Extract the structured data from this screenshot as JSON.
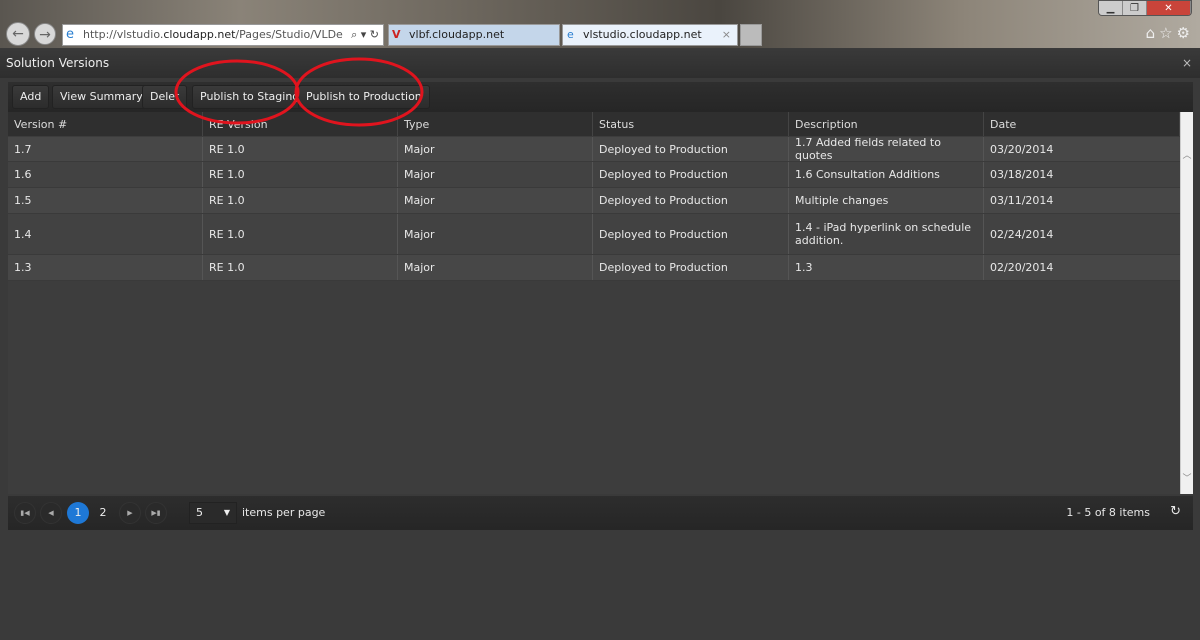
{
  "browser": {
    "url_prefix": "http://vlstudio.",
    "url_domain": "cloudapp.net",
    "url_path": "/Pages/Studio/VLDe",
    "tabs": [
      {
        "label": "vlbf.cloudapp.net"
      },
      {
        "label": "vlstudio.cloudapp.net"
      }
    ],
    "tab_close": "×"
  },
  "window": {
    "title": "Solution Versions",
    "close": "×"
  },
  "toolbar": {
    "add": "Add",
    "view_summary": "View Summary",
    "delete": "Delet",
    "publish_staging": "Publish to Staging",
    "publish_production": "Publish to Production"
  },
  "grid": {
    "columns": [
      "Version #",
      "RE Version",
      "Type",
      "Status",
      "Description",
      "Date"
    ],
    "rows": [
      [
        "1.7",
        "RE 1.0",
        "Major",
        "Deployed to Production",
        "1.7 Added fields related to quotes",
        "03/20/2014"
      ],
      [
        "1.6",
        "RE 1.0",
        "Major",
        "Deployed to Production",
        "1.6 Consultation Additions",
        "03/18/2014"
      ],
      [
        "1.5",
        "RE 1.0",
        "Major",
        "Deployed to Production",
        "Multiple changes",
        "03/11/2014"
      ],
      [
        "1.4",
        "RE 1.0",
        "Major",
        "Deployed to Production",
        "1.4 - iPad hyperlink on schedule addition.",
        "02/24/2014"
      ],
      [
        "1.3",
        "RE 1.0",
        "Major",
        "Deployed to Production",
        "1.3",
        "02/20/2014"
      ]
    ]
  },
  "pager": {
    "pages": [
      "1",
      "2"
    ],
    "current_page": "1",
    "page_size": "5",
    "items_per_page": "items per page",
    "summary": "1 - 5 of 8 items"
  },
  "annotation_color": "#e0141e"
}
